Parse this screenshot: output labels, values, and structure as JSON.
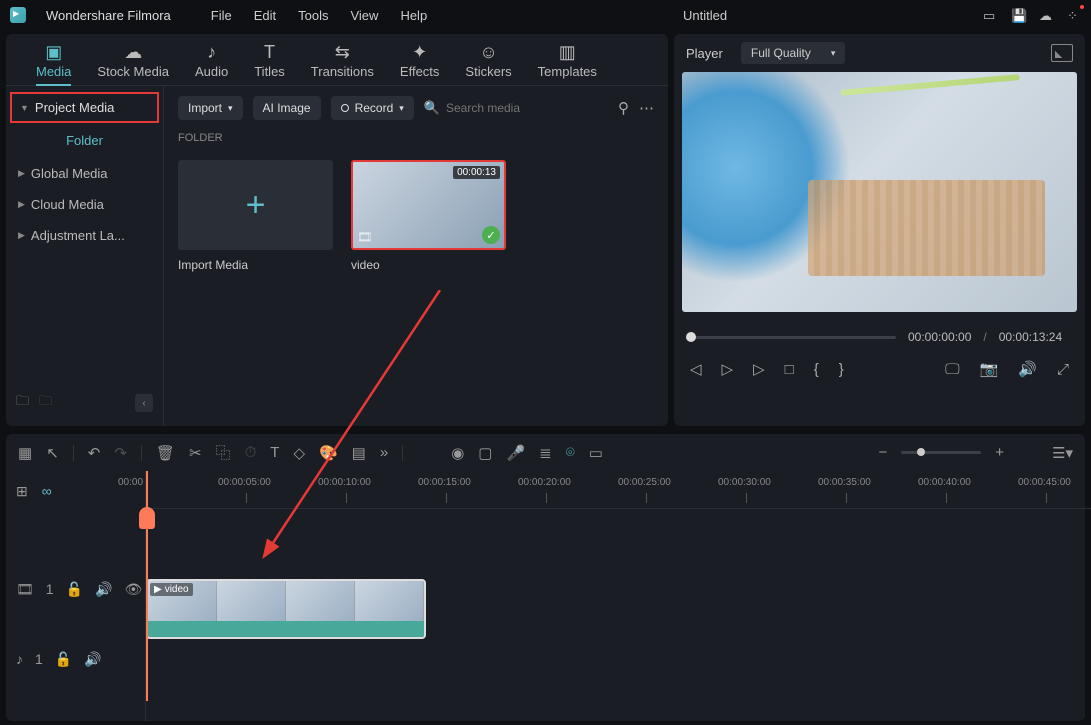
{
  "app": {
    "name": "Wondershare Filmora"
  },
  "menu": [
    "File",
    "Edit",
    "Tools",
    "View",
    "Help"
  ],
  "document": {
    "title": "Untitled"
  },
  "tabs": [
    {
      "label": "Media",
      "active": true
    },
    {
      "label": "Stock Media"
    },
    {
      "label": "Audio"
    },
    {
      "label": "Titles"
    },
    {
      "label": "Transitions"
    },
    {
      "label": "Effects"
    },
    {
      "label": "Stickers"
    },
    {
      "label": "Templates"
    }
  ],
  "sidebar": {
    "project_media": "Project Media",
    "folder_label": "Folder",
    "items": [
      {
        "label": "Global Media"
      },
      {
        "label": "Cloud Media"
      },
      {
        "label": "Adjustment La..."
      }
    ]
  },
  "media_toolbar": {
    "import": "Import",
    "ai_image": "AI Image",
    "record": "Record",
    "search_placeholder": "Search media"
  },
  "folder_header": "FOLDER",
  "thumbs": {
    "import_caption": "Import Media",
    "video": {
      "caption": "video",
      "duration": "00:00:13"
    }
  },
  "player": {
    "label": "Player",
    "quality": "Full Quality",
    "time_current": "00:00:00:00",
    "time_total": "00:00:13:24"
  },
  "ruler": [
    "00:00",
    "00:00:05:00",
    "00:00:10:00",
    "00:00:15:00",
    "00:00:20:00",
    "00:00:25:00",
    "00:00:30:00",
    "00:00:35:00",
    "00:00:40:00",
    "00:00:45:00"
  ],
  "clip": {
    "label": "video"
  },
  "track_heads": {
    "video_count": "1",
    "audio_count": "1"
  }
}
